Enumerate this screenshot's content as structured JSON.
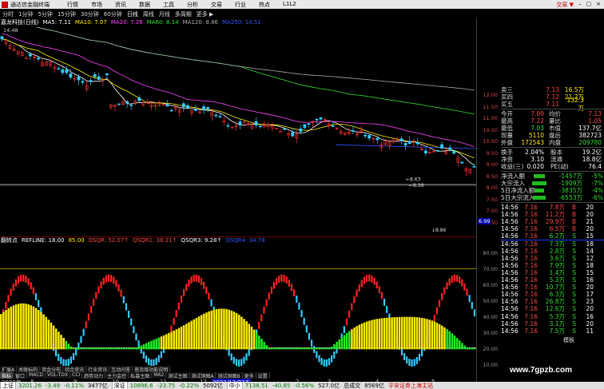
{
  "menu": {
    "app": "通达信金融终端",
    "items": [
      "行情",
      "市场",
      "资讯",
      "数据",
      "工具",
      "分析",
      "交易",
      "行业",
      "热点",
      "L1L2"
    ],
    "trade": "交易 ▼",
    "window_ctrl": [
      "–",
      "▢",
      "×"
    ]
  },
  "periods": [
    "分时",
    "1分钟",
    "5分钟",
    "15分钟",
    "30分钟",
    "60分钟",
    "日线",
    "周线",
    "月线",
    "多周期",
    "更多 ▶"
  ],
  "active_period": "日线",
  "stock": {
    "name": "嘉龙科技(日线)",
    "ma": [
      {
        "label": "MA5: 7.11",
        "color": "#ffffff"
      },
      {
        "label": "MA10: 7.07",
        "color": "#ffee00"
      },
      {
        "label": "MA20: 7.26",
        "color": "#ff44ff"
      },
      {
        "label": "MA60: 8.14",
        "color": "#33dd33"
      },
      {
        "label": "MA120: 8.86",
        "color": "#aaaaaa"
      },
      {
        "label": "MA250: 10.51",
        "color": "#3355ff"
      }
    ],
    "high_label": "14.48",
    "annot1": "8.63",
    "annot2": "8.39",
    "annot3": "8.86",
    "last_price_tag": "6.99"
  },
  "price_axis": [
    "12.00",
    "11.50",
    "11.00",
    "10.50",
    "10.00",
    "9.50",
    "9.00",
    "8.50",
    "8.00",
    "7.50",
    "7.00",
    "6.50"
  ],
  "indicator": {
    "name": "翻转点",
    "items": [
      {
        "label": "REFLINE: 18.00",
        "color": "#ffffff"
      },
      {
        "label": "85.00",
        "color": "#ffee00"
      },
      {
        "label": "QSQR: 52.07↑",
        "color": "#ff4444"
      },
      {
        "label": "QSQR1: 38.21↑",
        "color": "#ff4444"
      },
      {
        "label": "QSQR3: 9.28↑",
        "color": "#ffffff"
      },
      {
        "label": "QSQR4: 34.78",
        "color": "#3355ff"
      }
    ],
    "axis": [
      "80.00",
      "70.00",
      "60.00",
      "50.00",
      "40.00",
      "30.00",
      "20.00",
      "10.00"
    ]
  },
  "dates": [
    "2022年",
    "8",
    "9",
    "10",
    "11",
    "12",
    "2022/12/23五",
    "2",
    "3",
    "4",
    "5"
  ],
  "tabs": [
    "指标",
    "窗口",
    "MACD",
    "VOL-TDX",
    "CCI",
    "趋势动力",
    "主力监控",
    "私募主图",
    "MA2",
    "测试主图",
    "测试铜图A",
    "测试铜图B",
    "更多",
    "设置"
  ],
  "active_tab": "指标",
  "subtabs": [
    "扩展A",
    "关联标的",
    "资金分布",
    "综合资讯",
    "行业资讯",
    "互动问答",
    "普及版功能说明"
  ],
  "panel": {
    "order_rows": [
      {
        "label": "卖三",
        "price": "7.13",
        "vol": "16.5万"
      },
      {
        "label": "买四",
        "price": "7.12",
        "vol": "21.2万"
      },
      {
        "label": "买五",
        "price": "7.11",
        "vol": "132.3万"
      }
    ],
    "stats": [
      {
        "l1": "今开",
        "v1": "7.09",
        "l2": "均价",
        "v2": "7.13"
      },
      {
        "l1": "最高",
        "v1": "7.22",
        "l2": "量比",
        "v2": "1.05"
      },
      {
        "l1": "最低",
        "v1": "7.03",
        "l2": "市值",
        "v2": "137.7亿"
      },
      {
        "l1": "现量",
        "v1": "5110",
        "l2": "盘后",
        "v2": "382723"
      },
      {
        "l1": "外盘",
        "v1": "172543",
        "l2": "内盘",
        "v2": "209780"
      }
    ],
    "fin": [
      {
        "l1": "换手",
        "v1": "2.04%",
        "l2": "股本",
        "v2": "19.2亿"
      },
      {
        "l1": "净资",
        "v1": "3.10",
        "l2": "流通",
        "v2": "18.8亿"
      },
      {
        "l1": "收益(三)",
        "v1": "0.020",
        "l2": "PE(动)",
        "v2": "76.4"
      }
    ],
    "flows": [
      {
        "label": "净流入额",
        "val": "-1457万",
        "pct": "-5%",
        "w": 14
      },
      {
        "label": "大宗流入",
        "val": "-1909万",
        "pct": "-7%",
        "w": 18
      },
      {
        "label": "5日净流入额",
        "val": "-3835万",
        "pct": "-4%",
        "w": 12
      },
      {
        "label": "5日大宗流入",
        "val": "-6553万",
        "pct": "-6%",
        "w": 16
      }
    ],
    "ticks": [
      {
        "t": "14:56",
        "p": "7.16",
        "v": "7.8万",
        "d": "B",
        "n": "20"
      },
      {
        "t": "14:56",
        "p": "7.16",
        "v": "11.2万",
        "d": "B",
        "n": "20"
      },
      {
        "t": "14:56",
        "p": "7.16",
        "v": "29.9万",
        "d": "B",
        "n": "21"
      },
      {
        "t": "14:56",
        "p": "7.16",
        "v": "6.5万",
        "d": "B",
        "n": "20"
      },
      {
        "t": "14:56",
        "p": "7.16",
        "v": "6.2万",
        "d": "S",
        "n": "15"
      },
      {
        "t": "14:56",
        "p": "7.16",
        "v": "7.3万",
        "d": "S",
        "n": "18"
      },
      {
        "t": "14:56",
        "p": "7.16",
        "v": "2.8万",
        "d": "S",
        "n": "14"
      },
      {
        "t": "14:56",
        "p": "7.16",
        "v": "3.6万",
        "d": "S",
        "n": "12"
      },
      {
        "t": "14:56",
        "p": "7.16",
        "v": "7.9万",
        "d": "S",
        "n": "18"
      },
      {
        "t": "14:56",
        "p": "7.16",
        "v": "1.4万",
        "d": "S",
        "n": "15"
      },
      {
        "t": "14:56",
        "p": "7.16",
        "v": "5.3万",
        "d": "S",
        "n": "16"
      },
      {
        "t": "14:56",
        "p": "7.16",
        "v": "10.7万",
        "d": "S",
        "n": "20"
      },
      {
        "t": "14:56",
        "p": "7.16",
        "v": "6.3万",
        "d": "S",
        "n": "17"
      },
      {
        "t": "14:56",
        "p": "7.16",
        "v": "26.8万",
        "d": "S",
        "n": "23"
      },
      {
        "t": "14:56",
        "p": "7.16",
        "v": "12.6万",
        "d": "S",
        "n": "20"
      },
      {
        "t": "14:56",
        "p": "7.16",
        "v": "5.3万",
        "d": "S",
        "n": "16"
      },
      {
        "t": "14:56",
        "p": "7.16",
        "v": "3.1万",
        "d": "S",
        "n": "20"
      },
      {
        "t": "14:56",
        "p": "7.16",
        "v": "7.5万",
        "d": "S",
        "n": "11"
      }
    ],
    "footer": "模板"
  },
  "status": {
    "items": [
      {
        "name": "上证",
        "val": "3201.26",
        "chg": "-3.49",
        "pct": "-0.11%",
        "amt": "3477亿"
      },
      {
        "name": "深证",
        "val": "10896.6",
        "chg": "-23.75",
        "pct": "-0.22%",
        "amt": "5092亿"
      },
      {
        "name": "中小",
        "val": "7138.51",
        "chg": "-40.85",
        "pct": "-0.56%",
        "amt": "527.0亿"
      }
    ],
    "extra": [
      "总成交",
      "8569亿"
    ],
    "tail": "平安证券上海主站",
    "watermark": "www.7gpzb.com"
  }
}
